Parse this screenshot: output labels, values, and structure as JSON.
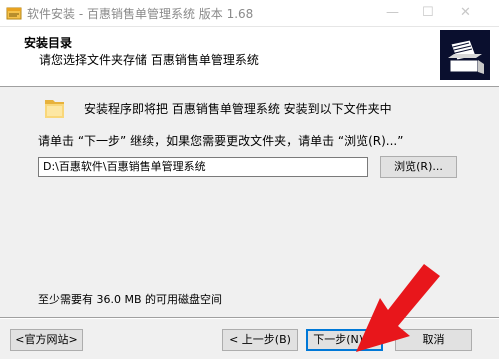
{
  "window": {
    "title": "软件安装 - 百惠销售单管理系统 版本 1.68",
    "min_glyph": "—",
    "max_glyph": "☐",
    "close_glyph": "✕"
  },
  "header": {
    "title": "安装目录",
    "subtitle": "请您选择文件夹存储 百惠销售单管理系统"
  },
  "main": {
    "intro": "安装程序即将把 百惠销售单管理系统 安装到以下文件夹中",
    "instruction": "请单击 “下一步” 继续，如果您需要更改文件夹，请单击 “浏览(R)...”",
    "path_value": "D:\\百惠软件\\百惠销售单管理系统",
    "browse_label": "浏览(R)...",
    "space_required": "至少需要有 36.0 MB 的可用磁盘空间"
  },
  "footer": {
    "site_label": "<官方网站>",
    "back_label": "< 上一步(B)",
    "next_label": "下一步(N) >",
    "cancel_label": "取消"
  },
  "colors": {
    "accent_border": "#0078d7",
    "arrow": "#e8161b"
  },
  "icons": [
    "app-icon",
    "installer-logo-icon",
    "folder-icon",
    "red-arrow-icon"
  ]
}
